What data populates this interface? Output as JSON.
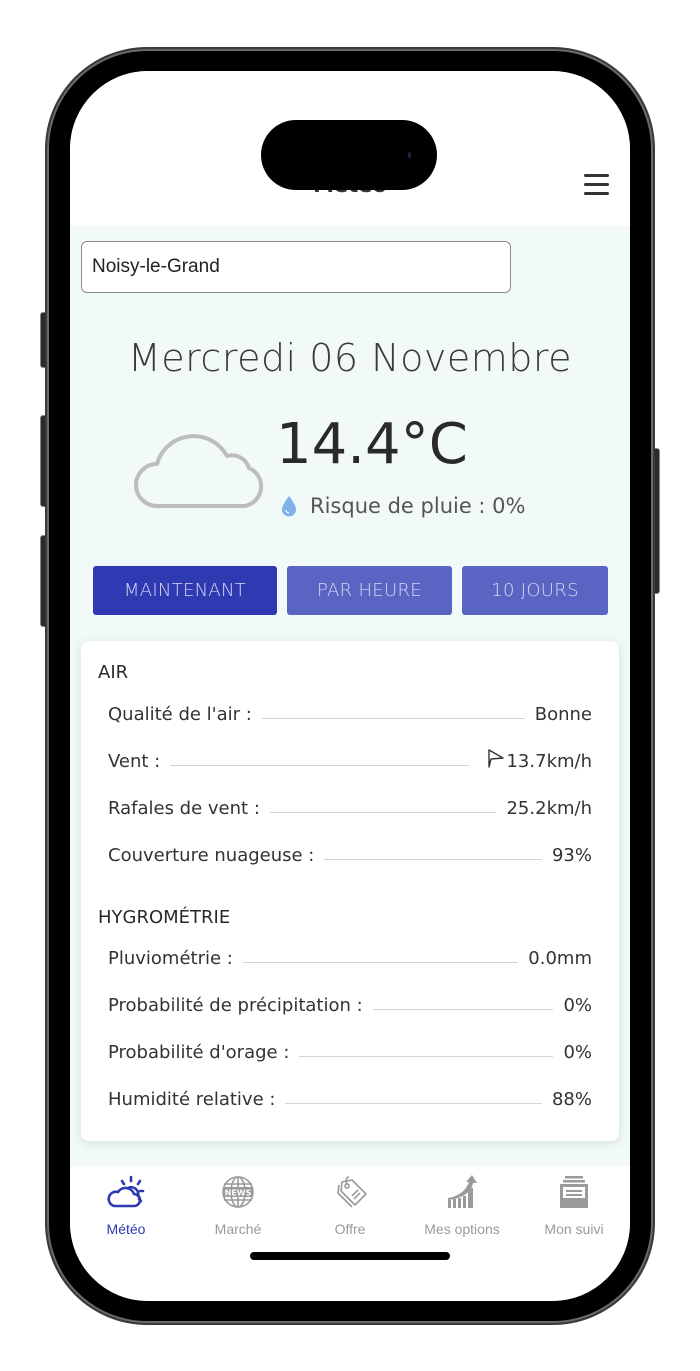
{
  "header": {
    "title": "Météo",
    "menu_icon": "hamburger-menu-icon"
  },
  "search": {
    "city_value": "Noisy-le-Grand",
    "placeholder": ""
  },
  "current": {
    "date": "Mercredi 06 Novembre",
    "condition_icon": "cloud-icon",
    "temperature": "14.4°C",
    "rain_icon": "water-drop-icon",
    "rain_risk": "Risque de pluie : 0%"
  },
  "view_tabs": [
    {
      "label": "MAINTENANT",
      "active": true
    },
    {
      "label": "PAR HEURE",
      "active": false
    },
    {
      "label": "10 JOURS",
      "active": false
    }
  ],
  "details": {
    "air": {
      "title": "AIR",
      "rows": [
        {
          "label": "Qualité de l'air :",
          "value": "Bonne"
        },
        {
          "label": "Vent :",
          "value": "13.7km/h",
          "icon": "wind-direction-arrow-icon"
        },
        {
          "label": "Rafales de vent :",
          "value": "25.2km/h"
        },
        {
          "label": "Couverture nuageuse :",
          "value": "93%"
        }
      ]
    },
    "hygrometry": {
      "title": "HYGROMÉTRIE",
      "rows": [
        {
          "label": "Pluviométrie :",
          "value": "0.0mm"
        },
        {
          "label": "Probabilité de précipitation :",
          "value": "0%"
        },
        {
          "label": "Probabilité d'orage :",
          "value": "0%"
        },
        {
          "label": "Humidité relative :",
          "value": "88%"
        }
      ]
    }
  },
  "bottom_nav": [
    {
      "label": "Météo",
      "icon": "weather-sun-cloud-icon",
      "active": true
    },
    {
      "label": "Marché",
      "icon": "news-globe-icon",
      "active": false
    },
    {
      "label": "Offre",
      "icon": "price-tag-icon",
      "active": false
    },
    {
      "label": "Mes options",
      "icon": "growth-chart-icon",
      "active": false
    },
    {
      "label": "Mon suivi",
      "icon": "card-file-box-icon",
      "active": false
    }
  ],
  "colors": {
    "accent": "#2f39b2",
    "tab_inactive": "#5a64c2",
    "content_bg": "#f1faf8",
    "inactive_icon": "#9a9a9a"
  }
}
